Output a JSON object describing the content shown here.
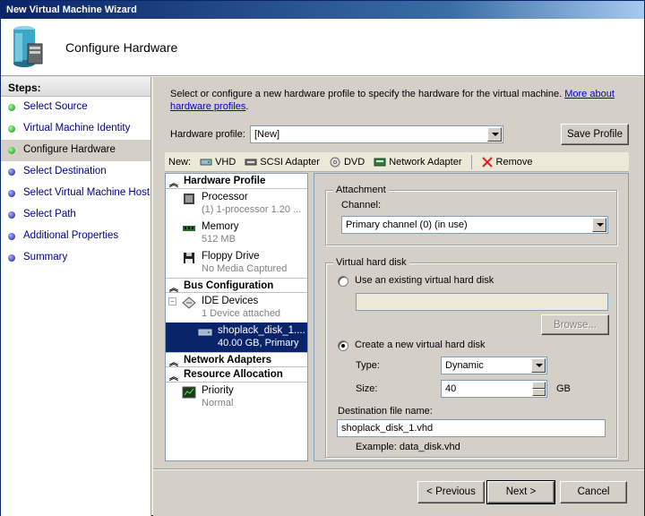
{
  "window": {
    "title": "New Virtual Machine Wizard"
  },
  "header": {
    "title": "Configure Hardware",
    "icon": "wizard-server-icon"
  },
  "steps": {
    "title": "Steps:",
    "items": [
      {
        "label": "Select Source",
        "status": "done"
      },
      {
        "label": "Virtual Machine Identity",
        "status": "done"
      },
      {
        "label": "Configure Hardware",
        "status": "current"
      },
      {
        "label": "Select Destination",
        "status": "pending"
      },
      {
        "label": "Select Virtual Machine Host",
        "status": "pending"
      },
      {
        "label": "Select Path",
        "status": "pending"
      },
      {
        "label": "Additional Properties",
        "status": "pending"
      },
      {
        "label": "Summary",
        "status": "pending"
      }
    ]
  },
  "intro": {
    "text": "Select or configure a new hardware profile to specify the hardware for the virtual machine. ",
    "link": "More about hardware profiles",
    "tail": "."
  },
  "hardware_profile": {
    "label": "Hardware profile:",
    "value": "[New]",
    "save_button": "Save Profile"
  },
  "toolbar": {
    "new_label": "New:",
    "items": [
      "VHD",
      "SCSI Adapter",
      "DVD",
      "Network Adapter"
    ],
    "remove_label": "Remove"
  },
  "tree": {
    "hardware_profile": "Hardware Profile",
    "processor": {
      "name": "Processor",
      "detail": "(1) 1-processor 1.20 ..."
    },
    "memory": {
      "name": "Memory",
      "detail": "512 MB"
    },
    "floppy": {
      "name": "Floppy Drive",
      "detail": "No Media Captured"
    },
    "bus_configuration": "Bus Configuration",
    "ide": {
      "name": "IDE Devices",
      "detail": "1 Device attached"
    },
    "disk": {
      "name": "shoplack_disk_1....",
      "detail": "40.00 GB, Primary"
    },
    "network_adapters": "Network Adapters",
    "resource_allocation": "Resource Allocation",
    "priority": {
      "name": "Priority",
      "detail": "Normal"
    }
  },
  "attachment": {
    "legend": "Attachment",
    "channel_label": "Channel:",
    "channel_value": "Primary channel (0) (in use)"
  },
  "vhd": {
    "legend": "Virtual hard disk",
    "use_existing": "Use an existing virtual hard disk",
    "existing_path": "",
    "browse_button": "Browse...",
    "create_new": "Create a new virtual hard disk",
    "type_label": "Type:",
    "type_value": "Dynamic",
    "size_label": "Size:",
    "size_value": "40",
    "size_unit": "GB",
    "dest_label": "Destination file name:",
    "dest_value": "shoplack_disk_1.vhd",
    "example": "Example: data_disk.vhd"
  },
  "footer": {
    "previous": "< Previous",
    "next": "Next >",
    "cancel": "Cancel"
  }
}
